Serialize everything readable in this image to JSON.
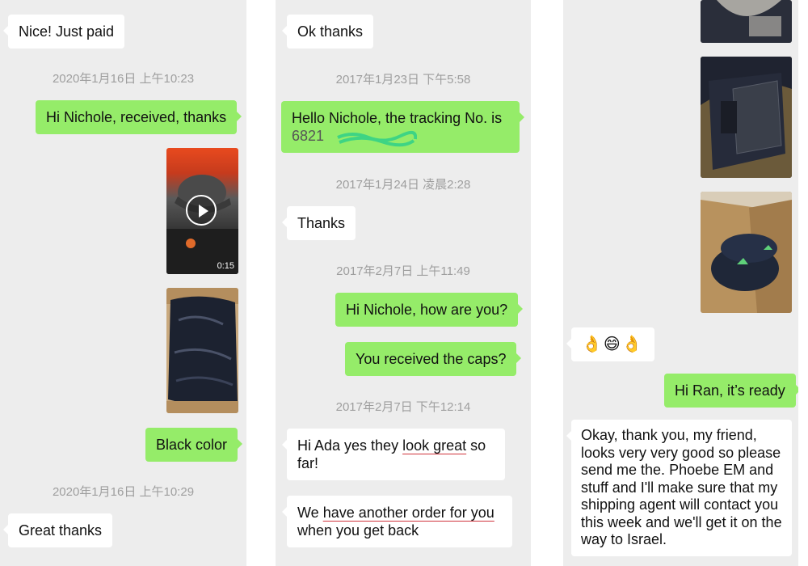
{
  "panel1": {
    "msg_nice": "Nice! Just paid",
    "ts1": "2020年1月16日 上午10:23",
    "msg_received": "Hi Nichole, received, thanks",
    "video_duration": "0:15",
    "msg_black": "Black color",
    "ts2": "2020年1月16日 上午10:29",
    "msg_great": "Great thanks"
  },
  "panel2": {
    "msg_ok": "Ok thanks",
    "ts1": "2017年1月23日 下午5:58",
    "msg_tracking_line1": "Hello Nichole, the tracking No. is",
    "msg_tracking_line2": "6821",
    "ts2": "2017年1月24日 凌晨2:28",
    "msg_thanks": "Thanks",
    "ts3": "2017年2月7日 上午11:49",
    "msg_how": "Hi Nichole, how are you?",
    "msg_caps": "You received the caps?",
    "ts4": "2017年2月7日 下午12:14",
    "msg_ada_a": "Hi Ada yes they ",
    "msg_ada_b": "look great",
    "msg_ada_c": " so\nfar!",
    "msg_order_a": "We ",
    "msg_order_b": "have another order for you",
    "msg_order_c": "\nwhen you get back"
  },
  "panel3": {
    "emoji_msg": "👌😄👌",
    "msg_ready": "Hi Ran, it’s ready",
    "msg_okay": "Okay, thank you, my friend,\nlooks very very good so please\nsend me the. Phoebe EM and\nstuff and I'll make sure that my\nshipping agent will contact you\nthis week and we'll get it on the\nway to Israel."
  },
  "colors": {
    "chat_bg": "#ededed",
    "outgoing": "#95ec69",
    "incoming": "#ffffff",
    "timestamp": "#9e9e9e",
    "underline": "#d0343c"
  }
}
